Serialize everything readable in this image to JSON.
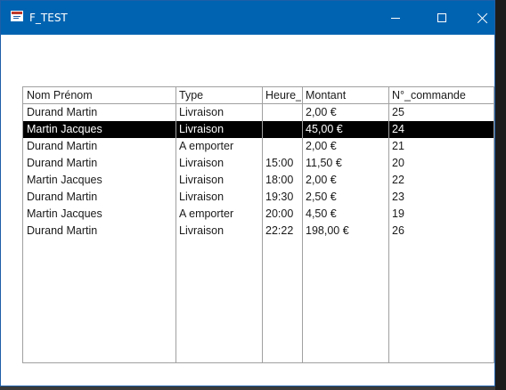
{
  "window": {
    "title": "F_TEST"
  },
  "icons": {
    "app": "form-icon",
    "minimize": "minimize-icon",
    "maximize": "maximize-icon",
    "close": "close-icon"
  },
  "colors": {
    "titlebar": "#0063b1",
    "selection": "#000000"
  },
  "list": {
    "headers": [
      "Nom Prénom",
      "Type",
      "Heure_",
      "Montant",
      "N°_commande"
    ],
    "rows": [
      {
        "name": "Durand Martin",
        "type": "Livraison",
        "heure": "",
        "montant": "2,00 €",
        "commande": "25",
        "selected": false
      },
      {
        "name": "Martin Jacques",
        "type": "Livraison",
        "heure": "",
        "montant": "45,00 €",
        "commande": "24",
        "selected": true
      },
      {
        "name": "Durand Martin",
        "type": "A emporter",
        "heure": "",
        "montant": "2,00 €",
        "commande": "21",
        "selected": false
      },
      {
        "name": "Durand Martin",
        "type": "Livraison",
        "heure": "15:00",
        "montant": "11,50 €",
        "commande": "20",
        "selected": false
      },
      {
        "name": "Martin Jacques",
        "type": "Livraison",
        "heure": "18:00",
        "montant": "2,00 €",
        "commande": "22",
        "selected": false
      },
      {
        "name": "Durand Martin",
        "type": "Livraison",
        "heure": "19:30",
        "montant": "2,50 €",
        "commande": "23",
        "selected": false
      },
      {
        "name": "Martin Jacques",
        "type": "A emporter",
        "heure": "20:00",
        "montant": "4,50 €",
        "commande": "19",
        "selected": false
      },
      {
        "name": "Durand Martin",
        "type": "Livraison",
        "heure": "22:22",
        "montant": "198,00 €",
        "commande": "26",
        "selected": false
      }
    ]
  }
}
